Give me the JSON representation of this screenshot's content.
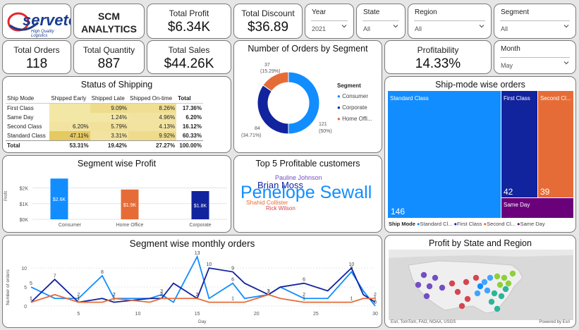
{
  "brand": {
    "name": "serveto",
    "tagline": "High Quality Logistics"
  },
  "header": {
    "title_line1": "SCM",
    "title_line2": "ANALYTICS"
  },
  "kpis": {
    "total_profit": {
      "label": "Total Profit",
      "value": "$6.34K"
    },
    "total_discount": {
      "label": "Total Discount",
      "value": "$36.89"
    },
    "total_orders": {
      "label": "Total Orders",
      "value": "118"
    },
    "total_quantity": {
      "label": "Total Quantity",
      "value": "887"
    },
    "total_sales": {
      "label": "Total Sales",
      "value": "$44.26K"
    },
    "profitability": {
      "label": "Profitability",
      "value": "14.33%"
    }
  },
  "slicers": {
    "year": {
      "label": "Year",
      "value": "2021"
    },
    "state": {
      "label": "State",
      "value": "All"
    },
    "region": {
      "label": "Region",
      "value": "All"
    },
    "segment": {
      "label": "Segment",
      "value": "All"
    },
    "month": {
      "label": "Month",
      "value": "May"
    }
  },
  "colors": {
    "blue": "#118dff",
    "navy": "#12239e",
    "orange": "#e66c37",
    "purple": "#6b007b",
    "highlight_light": "#f3e7a6",
    "highlight_dark": "#e5c961"
  },
  "status_of_shipping": {
    "title": "Status of Shipping",
    "columns": [
      "Ship Mode",
      "Shipped Early",
      "Shipped Late",
      "Shipped On-time",
      "Total"
    ],
    "rows": [
      [
        "First Class",
        "",
        "9.09%",
        "8.26%",
        "17.36%"
      ],
      [
        "Same Day",
        "",
        "1.24%",
        "4.96%",
        "6.20%"
      ],
      [
        "Second Class",
        "6.20%",
        "5.79%",
        "4.13%",
        "16.12%"
      ],
      [
        "Standard Class",
        "47.11%",
        "3.31%",
        "9.92%",
        "60.33%"
      ]
    ],
    "total_row": [
      "Total",
      "53.31%",
      "19.42%",
      "27.27%",
      "100.00%"
    ]
  },
  "orders_by_segment": {
    "title": "Number of Orders by Segment",
    "legend_title": "Segment",
    "data_labels": [
      {
        "count": "121",
        "pct": "(50%)"
      },
      {
        "count": "84",
        "pct": "(34.71%)"
      },
      {
        "count": "37",
        "pct": "(15.29%)"
      }
    ],
    "legend": [
      "Consumer",
      "Corporate",
      "Home Offi..."
    ]
  },
  "ship_mode_orders": {
    "title": "Ship-mode wise orders",
    "tile_labels": [
      "Standard Class",
      "First Class",
      "Second Cl...",
      "Same Day"
    ],
    "tile_values": [
      "146",
      "42",
      "39",
      ""
    ],
    "legend_title": "Ship Mode",
    "legend": [
      "Standard Cl...",
      "First Class",
      "Second Cl...",
      "Same Day"
    ]
  },
  "segment_profit": {
    "title": "Segment wise Profit",
    "ylabel": "Profit",
    "yticks": [
      "$2K",
      "$1K",
      "$0K"
    ]
  },
  "top_customers": {
    "title": "Top 5 Profitable customers",
    "words": [
      "Pauline Johnson",
      "Brian Moss",
      "Penelope Sewall",
      "Shahid Collister",
      "Rick Wilson"
    ]
  },
  "monthly_orders": {
    "title": "Segment wise monthly orders",
    "xlabel": "Day",
    "ylabel": "Number of orders",
    "xticks": [
      "5",
      "10",
      "15",
      "20",
      "25",
      "30"
    ],
    "yticks": [
      "10",
      "5",
      "0"
    ]
  },
  "profit_map": {
    "title": "Profit by State and Region",
    "attribution": "Esri, TomTom, FAO, NOAA, USGS",
    "powered": "Powered by Esri"
  },
  "chart_data": [
    {
      "type": "pie",
      "title": "Number of Orders by Segment",
      "categories": [
        "Consumer",
        "Corporate",
        "Home Office"
      ],
      "values": [
        121,
        84,
        37
      ],
      "colors": [
        "#118dff",
        "#12239e",
        "#e66c37"
      ],
      "legend": "right"
    },
    {
      "type": "bar",
      "title": "Segment wise Profit",
      "categories": [
        "Consumer",
        "Home Office",
        "Corporate"
      ],
      "values": [
        2.6,
        1.9,
        1.8
      ],
      "value_labels": [
        "$2.6K",
        "$1.9K",
        "$1.8K"
      ],
      "colors": [
        "#118dff",
        "#e66c37",
        "#12239e"
      ],
      "ylabel": "Profit",
      "ylim": [
        0,
        2.7
      ]
    },
    {
      "type": "treemap",
      "title": "Ship-mode wise orders",
      "categories": [
        "Standard Class",
        "First Class",
        "Second Class",
        "Same Day"
      ],
      "values": [
        146,
        42,
        39,
        15
      ],
      "colors": [
        "#118dff",
        "#12239e",
        "#e66c37",
        "#6b007b"
      ]
    },
    {
      "type": "line",
      "title": "Segment wise monthly orders",
      "xlabel": "Day",
      "ylabel": "Number of orders",
      "x": [
        1,
        3,
        5,
        7,
        8,
        11,
        12,
        13,
        15,
        16,
        18,
        19,
        21,
        22,
        24,
        26,
        28,
        29,
        30
      ],
      "xlim": [
        1,
        30
      ],
      "ylim": [
        0,
        13
      ],
      "series": [
        {
          "color": "#118dff",
          "values": [
            5,
            2,
            2,
            8,
            2,
            2,
            3,
            1,
            13,
            2,
            6,
            2,
            3,
            5,
            2,
            2,
            9,
            4,
            0
          ]
        },
        {
          "color": "#12239e",
          "values": [
            1,
            7,
            1,
            2,
            1,
            2,
            2,
            6,
            2,
            10,
            9,
            6,
            3,
            5,
            6,
            4,
            10,
            3,
            1
          ]
        },
        {
          "color": "#e66c37",
          "values": [
            1,
            3,
            1,
            1,
            2,
            1,
            2,
            2,
            2,
            1,
            1,
            1,
            3,
            2,
            1,
            1,
            1,
            2,
            2
          ]
        }
      ]
    }
  ]
}
